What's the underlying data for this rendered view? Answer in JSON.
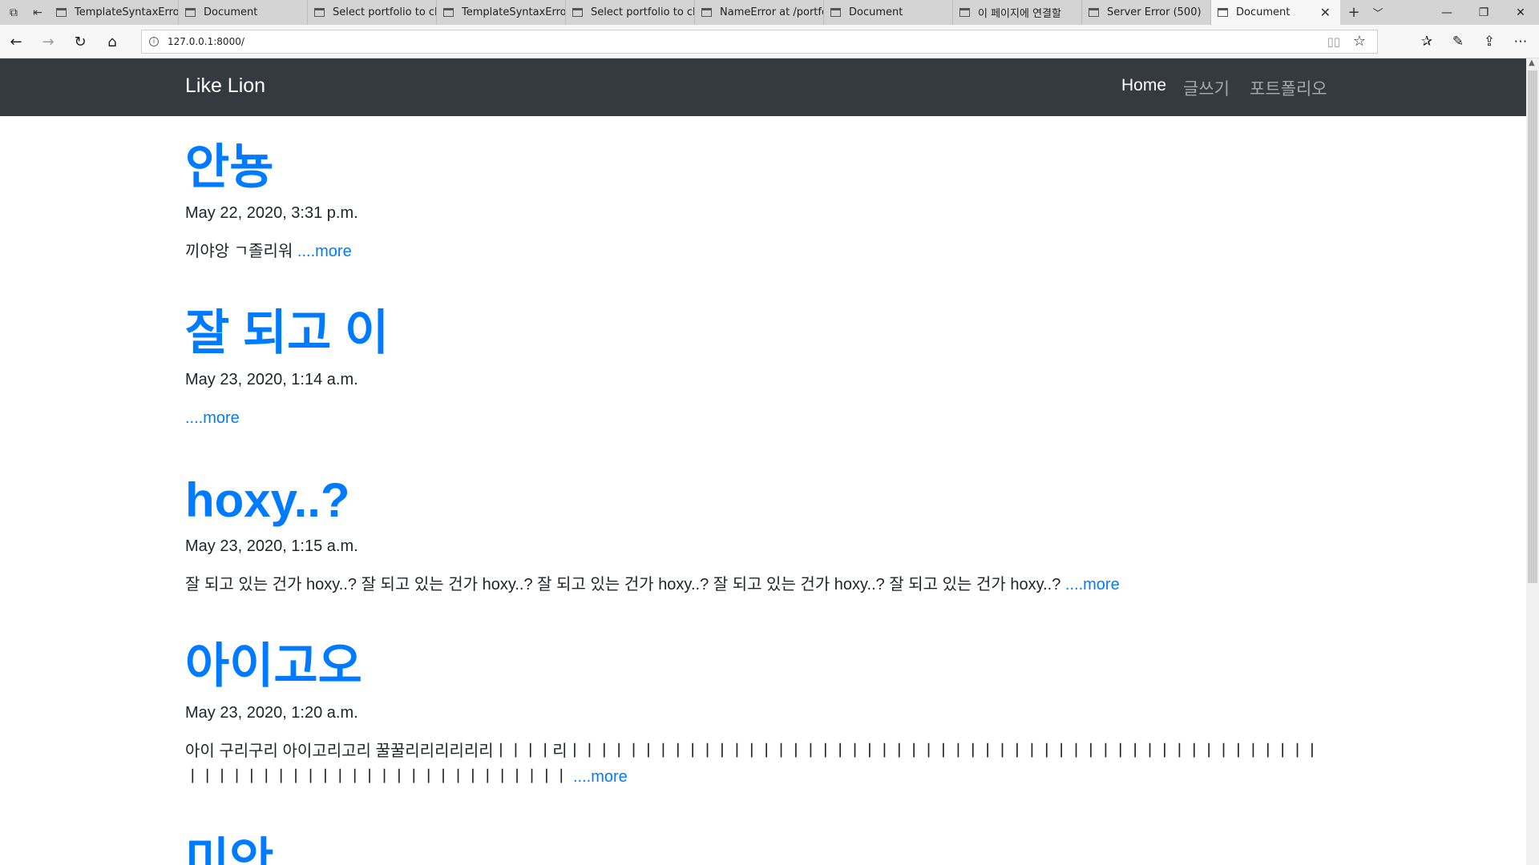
{
  "browser": {
    "tabs": [
      {
        "title": "TemplateSyntaxError"
      },
      {
        "title": "Document"
      },
      {
        "title": "Select portfolio to ch"
      },
      {
        "title": "TemplateSyntaxError"
      },
      {
        "title": "Select portfolio to ch"
      },
      {
        "title": "NameError at /portfo"
      },
      {
        "title": "Document"
      },
      {
        "title": "이 페이지에 연결할"
      },
      {
        "title": "Server Error (500)"
      },
      {
        "title": "Document"
      }
    ],
    "active_tab_index": 9,
    "url": "127.0.0.1:8000/"
  },
  "navbar": {
    "brand": "Like Lion",
    "links": [
      {
        "label": "Home",
        "active": true
      },
      {
        "label": "글쓰기",
        "active": false
      },
      {
        "label": "포트폴리오",
        "active": false
      }
    ]
  },
  "posts": [
    {
      "title": "안뇽",
      "date": "May 22, 2020, 3:31 p.m.",
      "summary": "끼야앙 ㄱ졸리워 ",
      "more": "....more"
    },
    {
      "title": "잘 되고 이",
      "date": "May 23, 2020, 1:14 a.m.",
      "summary": "",
      "more": "....more"
    },
    {
      "title": "hoxy..?",
      "date": "May 23, 2020, 1:15 a.m.",
      "summary": "잘 되고 있는 건가 hoxy..? 잘 되고 있는 건가 hoxy..? 잘 되고 있는 건가 hoxy..? 잘 되고 있는 건가 hoxy..? 잘 되고 있는 건가 hoxy..? ",
      "more": "....more"
    },
    {
      "title": "아이고오",
      "date": "May 23, 2020, 1:20 a.m.",
      "summary": "아이 구리구리 아이고리고리 꿀꿀리리리리리리ㅣㅣㅣㅣ리ㅣㅣㅣㅣㅣㅣㅣㅣㅣㅣㅣㅣㅣㅣㅣㅣㅣㅣㅣㅣㅣㅣㅣㅣㅣㅣㅣㅣㅣㅣㅣㅣㅣㅣㅣㅣㅣㅣㅣㅣㅣㅣㅣㅣㅣㅣㅣㅣㅣㅣㅣㅣㅣㅣㅣㅣㅣㅣㅣㅣㅣㅣㅣㅣㅣㅣㅣㅣㅣㅣㅣㅣㅣㅣㅣㅣㅣ ",
      "more": "....more"
    },
    {
      "title": "미안",
      "date": "",
      "summary": "",
      "more": ""
    }
  ]
}
